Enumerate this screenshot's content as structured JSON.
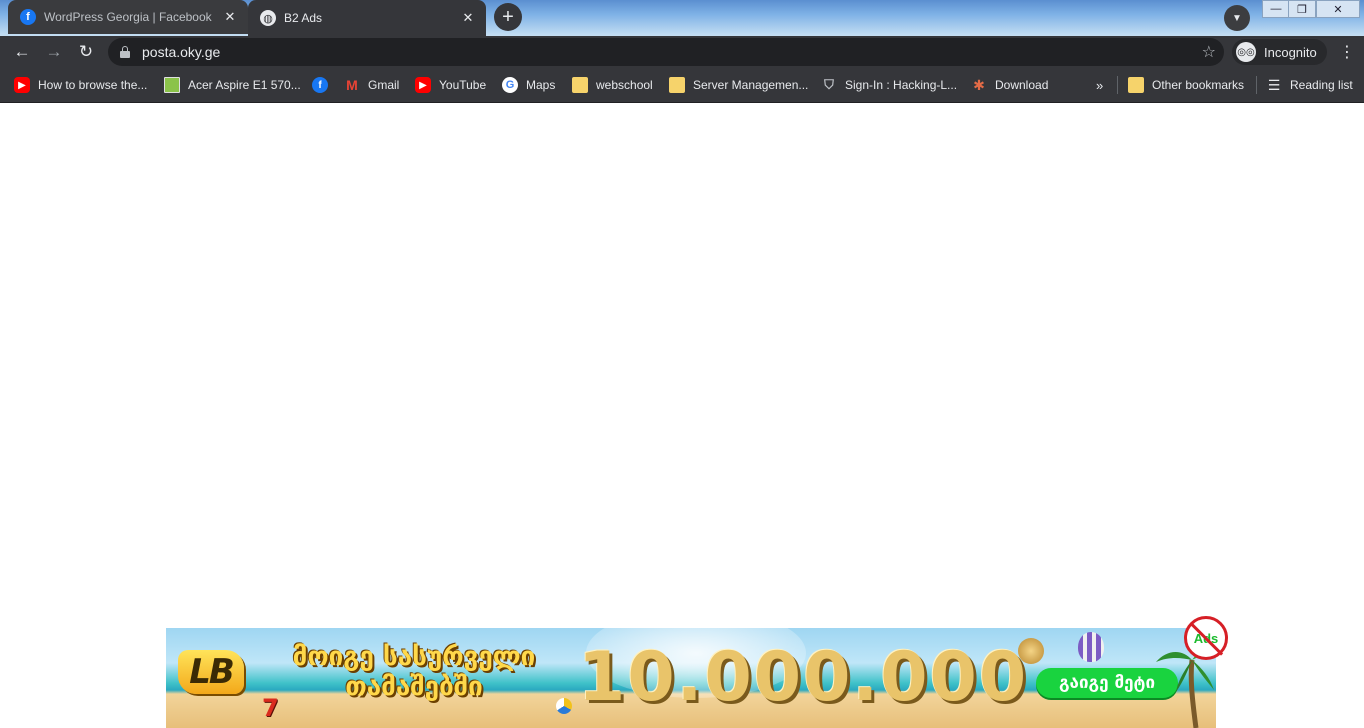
{
  "tabs": [
    {
      "title": "WordPress Georgia | Facebook",
      "favicon": "facebook-icon",
      "active": false
    },
    {
      "title": "B2 Ads",
      "favicon": "globe-icon",
      "active": true
    }
  ],
  "toolbar": {
    "url": "posta.oky.ge",
    "profile_label": "Incognito"
  },
  "bookmarks": [
    {
      "label": "How to browse the...",
      "icon": "youtube-icon"
    },
    {
      "label": "Acer Aspire E1 570...",
      "icon": "acer-icon"
    },
    {
      "label": "",
      "icon": "facebook-icon"
    },
    {
      "label": "Gmail",
      "icon": "gmail-icon"
    },
    {
      "label": "YouTube",
      "icon": "youtube-icon"
    },
    {
      "label": "Maps",
      "icon": "google-icon"
    },
    {
      "label": "webschool",
      "icon": "folder-icon"
    },
    {
      "label": "Server Managemen...",
      "icon": "folder-icon"
    },
    {
      "label": "Sign-In : Hacking-L...",
      "icon": "shield-icon"
    },
    {
      "label": "Download",
      "icon": "download-icon"
    }
  ],
  "bookmarks_right": {
    "other": "Other bookmarks",
    "reading": "Reading list"
  },
  "ad": {
    "logo": "LB",
    "slogan": "მოიგე სასურველი თამაშებში",
    "amount": "10.000.000",
    "cta": "გაიგე მეტი",
    "seven": "7",
    "adblock_text": "Ads"
  },
  "colors": {
    "chrome_dark": "#202124",
    "toolbar": "#35363a",
    "cta_green": "#19d33f",
    "adblock_red": "#d61f26"
  }
}
